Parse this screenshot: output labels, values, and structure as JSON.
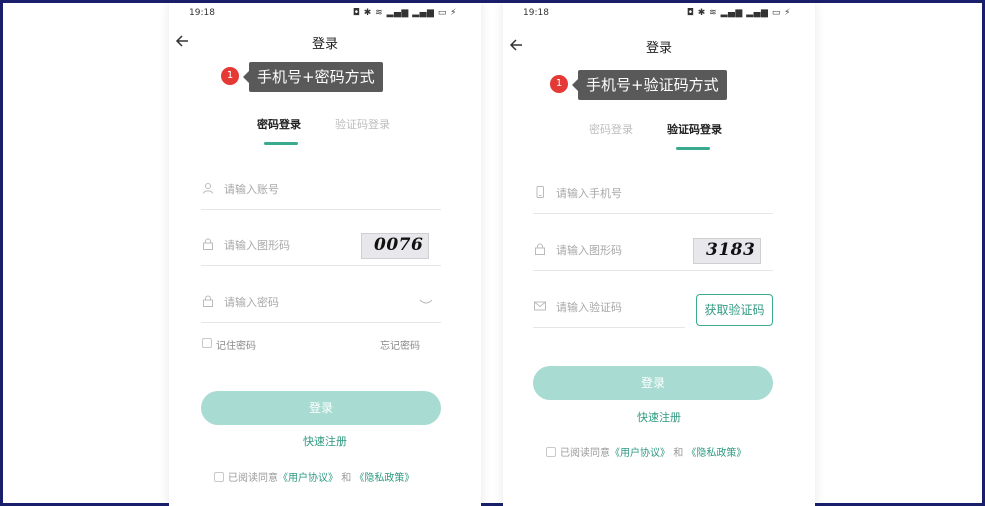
{
  "left": {
    "status": {
      "time": "19:18",
      "icons": "◘ ✱ ≋ ▂▄▆ ▂▄▆ ▭ ⚡"
    },
    "title": "登录",
    "callout": {
      "number": "1",
      "text": "手机号+密码方式"
    },
    "tabs": [
      {
        "label": "密码登录",
        "active": true
      },
      {
        "label": "验证码登录",
        "active": false
      }
    ],
    "fields": {
      "account": {
        "placeholder": "请输入账号",
        "icon": "user-icon"
      },
      "captcha": {
        "placeholder": "请输入图形码",
        "icon": "lock-icon",
        "captcha_text": "0076"
      },
      "password": {
        "placeholder": "请输入密码",
        "icon": "lock-icon",
        "toggle_icon": "eye-closed-icon"
      }
    },
    "remember_label": "记住密码",
    "forgot_label": "忘记密码",
    "login_button": "登录",
    "register_link": "快速注册",
    "agreement": {
      "prefix": "已阅读同意",
      "user_agreement": "《用户协议》",
      "and": "和",
      "privacy": "《隐私政策》"
    }
  },
  "right": {
    "status": {
      "time": "19:18",
      "icons": "◘ ✱ ≋ ▂▄▆ ▂▄▆ ▭ ⚡"
    },
    "title": "登录",
    "callout": {
      "number": "1",
      "text": "手机号+验证码方式"
    },
    "tabs": [
      {
        "label": "密码登录",
        "active": false
      },
      {
        "label": "验证码登录",
        "active": true
      }
    ],
    "fields": {
      "phone": {
        "placeholder": "请输入手机号",
        "icon": "phone-icon"
      },
      "captcha": {
        "placeholder": "请输入图形码",
        "icon": "lock-icon",
        "captcha_text": "3183"
      },
      "sms_code": {
        "placeholder": "请输入验证码",
        "icon": "mail-icon"
      }
    },
    "get_code_button": "获取验证码",
    "login_button": "登录",
    "register_link": "快速注册",
    "agreement": {
      "prefix": "已阅读同意",
      "user_agreement": "《用户协议》",
      "and": "和",
      "privacy": "《隐私政策》"
    }
  },
  "colors": {
    "accent": "#3aaa8f",
    "login_button": "#a8dbd1",
    "callout_bg": "#595959",
    "badge": "#e53935",
    "frame": "#1a1f6b"
  }
}
